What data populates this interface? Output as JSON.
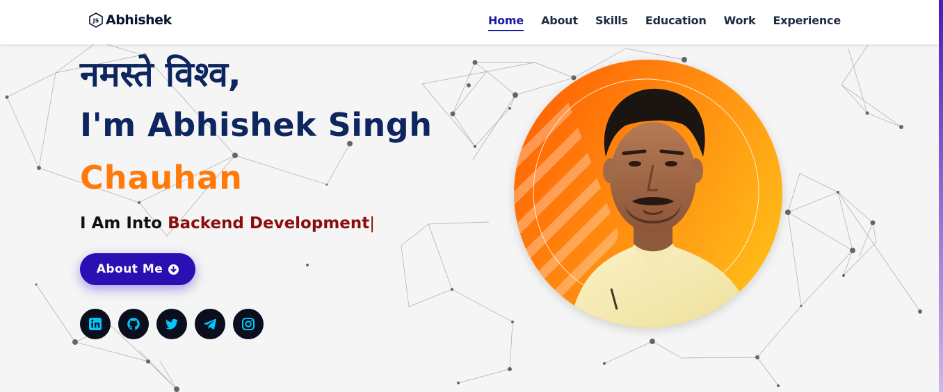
{
  "brand": {
    "name": "Abhishek",
    "logo_icon": "js-hexagon-icon"
  },
  "nav": {
    "items": [
      {
        "label": "Home",
        "active": true
      },
      {
        "label": "About",
        "active": false
      },
      {
        "label": "Skills",
        "active": false
      },
      {
        "label": "Education",
        "active": false
      },
      {
        "label": "Work",
        "active": false
      },
      {
        "label": "Experience",
        "active": false
      }
    ]
  },
  "hero": {
    "greeting": "नमस्ते विश्व,",
    "name_line1": "I'm Abhishek Singh",
    "name_line2": "Chauhan",
    "into_prefix": "I Am Into ",
    "role": "Backend Development",
    "caret": "|",
    "button_label": "About Me",
    "button_icon": "arrow-circle-down-icon"
  },
  "socials": [
    {
      "name": "linkedin",
      "icon": "linkedin-icon"
    },
    {
      "name": "github",
      "icon": "github-icon"
    },
    {
      "name": "twitter",
      "icon": "twitter-icon"
    },
    {
      "name": "telegram",
      "icon": "telegram-icon"
    },
    {
      "name": "instagram",
      "icon": "instagram-icon"
    }
  ],
  "colors": {
    "nav_active": "#1a1aa8",
    "heading": "#0d2660",
    "accent_orange": "#ff7a0a",
    "role_text": "#8b0d0d",
    "button_bg": "#2a0fb3",
    "social_bg": "#0b0e1c",
    "social_icon": "#00c8ff"
  }
}
